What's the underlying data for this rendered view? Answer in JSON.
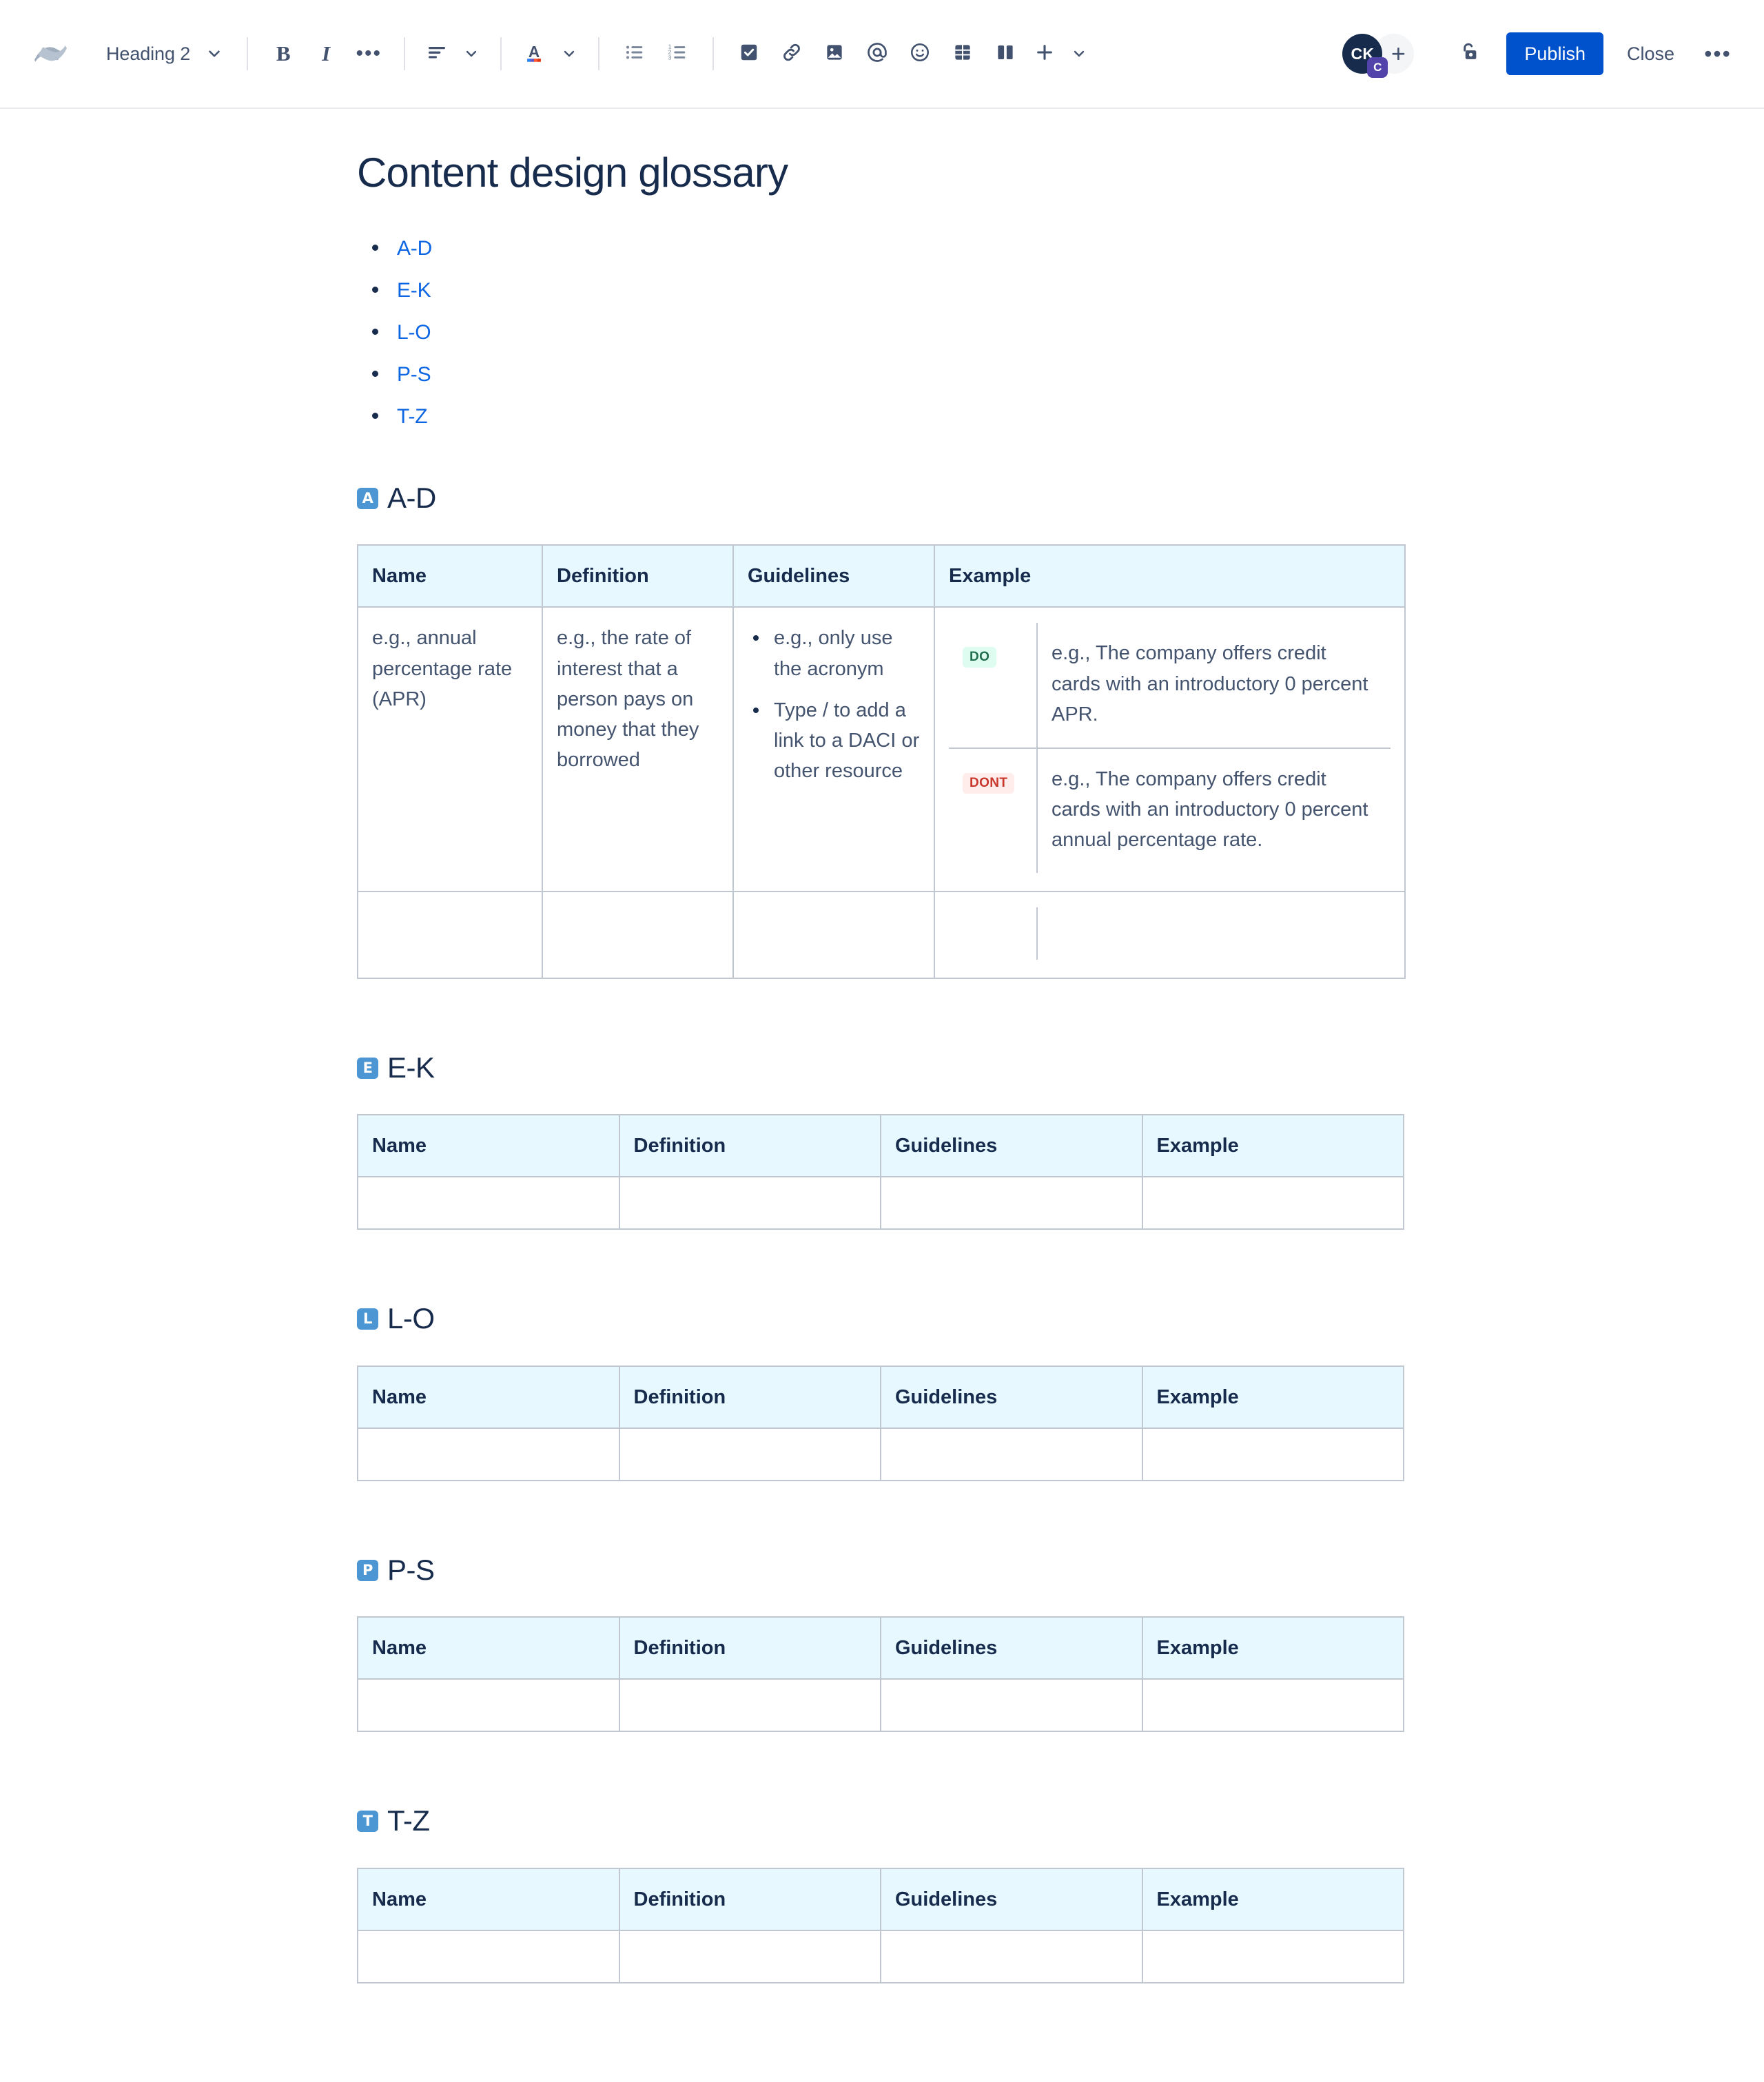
{
  "toolbar": {
    "logo_name": "confluence-logo",
    "style_selector": {
      "label": "Heading 2"
    },
    "bold_label": "B",
    "italic_label": "I",
    "more_formatting_label": "•••",
    "publish_label": "Publish",
    "close_label": "Close",
    "more_actions_label": "•••",
    "avatar": {
      "initials": "CK",
      "badge": "C"
    },
    "add_people_label": "+",
    "plus_insert_label": "+"
  },
  "document": {
    "title": "Content design glossary",
    "toc": [
      {
        "label": "A-D"
      },
      {
        "label": "E-K"
      },
      {
        "label": "L-O"
      },
      {
        "label": "P-S"
      },
      {
        "label": "T-Z"
      }
    ],
    "columns": [
      "Name",
      "Definition",
      "Guidelines",
      "Example"
    ],
    "sections": [
      {
        "emoji": "A",
        "title": "A-D",
        "row": {
          "name": "e.g., annual percentage rate (APR)",
          "definition": "e.g., the rate of interest that a person pays on money that they borrowed",
          "guidelines": [
            "e.g., only use the acronym",
            "Type / to add a link to a DACI or other resource"
          ],
          "examples": [
            {
              "badge": "DO",
              "text": "e.g., The company offers credit cards with an introductory 0 percent APR."
            },
            {
              "badge": "DONT",
              "text": "e.g., The company offers credit cards with an introductory 0 percent annual percentage rate."
            }
          ]
        }
      },
      {
        "emoji": "E",
        "title": "E-K"
      },
      {
        "emoji": "L",
        "title": "L-O"
      },
      {
        "emoji": "P",
        "title": "P-S"
      },
      {
        "emoji": "T",
        "title": "T-Z"
      }
    ]
  },
  "colors": {
    "accent": "#0052CC",
    "link": "#0C66E4",
    "table_header_bg": "#E7F9FF",
    "table_border": "#C1C7D0",
    "emoji_badge": "#4D96D4",
    "do_bg": "#DFFCF0",
    "do_text": "#216E4E",
    "dont_bg": "#FFEDEB",
    "dont_text": "#C9372C",
    "avatar_bg": "#172B4D",
    "avatar_badge_bg": "#5243AA"
  }
}
